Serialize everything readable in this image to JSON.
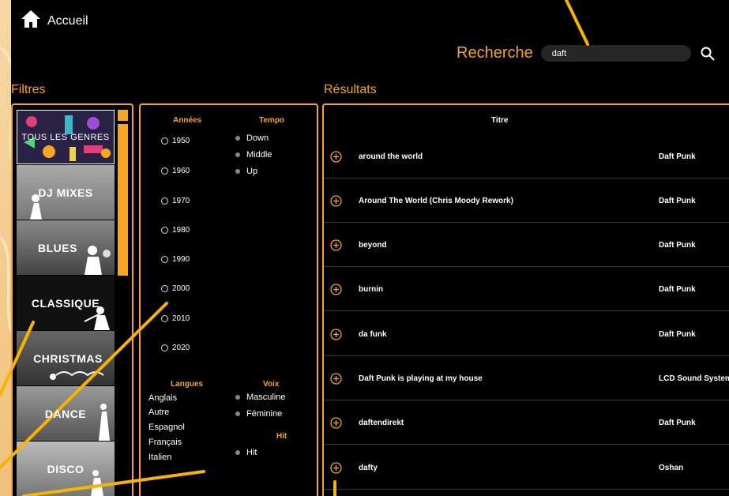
{
  "header": {
    "home_label": "Accueil",
    "home_icon": "home-icon"
  },
  "search": {
    "label": "Recherche",
    "value": "daft",
    "icon": "search-icon"
  },
  "sections": {
    "filters": "Filtres",
    "results": "Résultats"
  },
  "genres": [
    {
      "label": "TOUS LES GENRES",
      "selected": true
    },
    {
      "label": "DJ MIXES"
    },
    {
      "label": "BLUES"
    },
    {
      "label": "CLASSIQUE"
    },
    {
      "label": "CHRISTMAS"
    },
    {
      "label": "DANCE"
    },
    {
      "label": "DISCO"
    }
  ],
  "filters": {
    "years_label": "Années",
    "years": [
      "1950",
      "1960",
      "1970",
      "1980",
      "1990",
      "2000",
      "2010",
      "2020"
    ],
    "tempo_label": "Tempo",
    "tempo": [
      "Down",
      "Middle",
      "Up"
    ],
    "langues_label": "Langues",
    "langues": [
      "Anglais",
      "Autre",
      "Espagnol",
      "Français",
      "Italien"
    ],
    "voix_label": "Voix",
    "voix": [
      "Masculine",
      "Féminine"
    ],
    "hit_label": "Hit",
    "hit": [
      "Hit"
    ]
  },
  "results": {
    "column_title": "Titre",
    "rows": [
      {
        "title": "around the world",
        "artist": "Daft Punk"
      },
      {
        "title": "Around The World (Chris Moody Rework)",
        "artist": "Daft Punk"
      },
      {
        "title": "beyond",
        "artist": "Daft Punk"
      },
      {
        "title": "burnin",
        "artist": "Daft Punk"
      },
      {
        "title": "da funk",
        "artist": "Daft Punk"
      },
      {
        "title": "Daft Punk is playing at my house",
        "artist": "LCD Sound System"
      },
      {
        "title": "daftendirekt",
        "artist": "Daft Punk"
      },
      {
        "title": "dafty",
        "artist": "Oshan"
      }
    ]
  },
  "colors": {
    "accent": "#f6a623",
    "background": "#000000",
    "row_divider": "#3a3a3a"
  }
}
